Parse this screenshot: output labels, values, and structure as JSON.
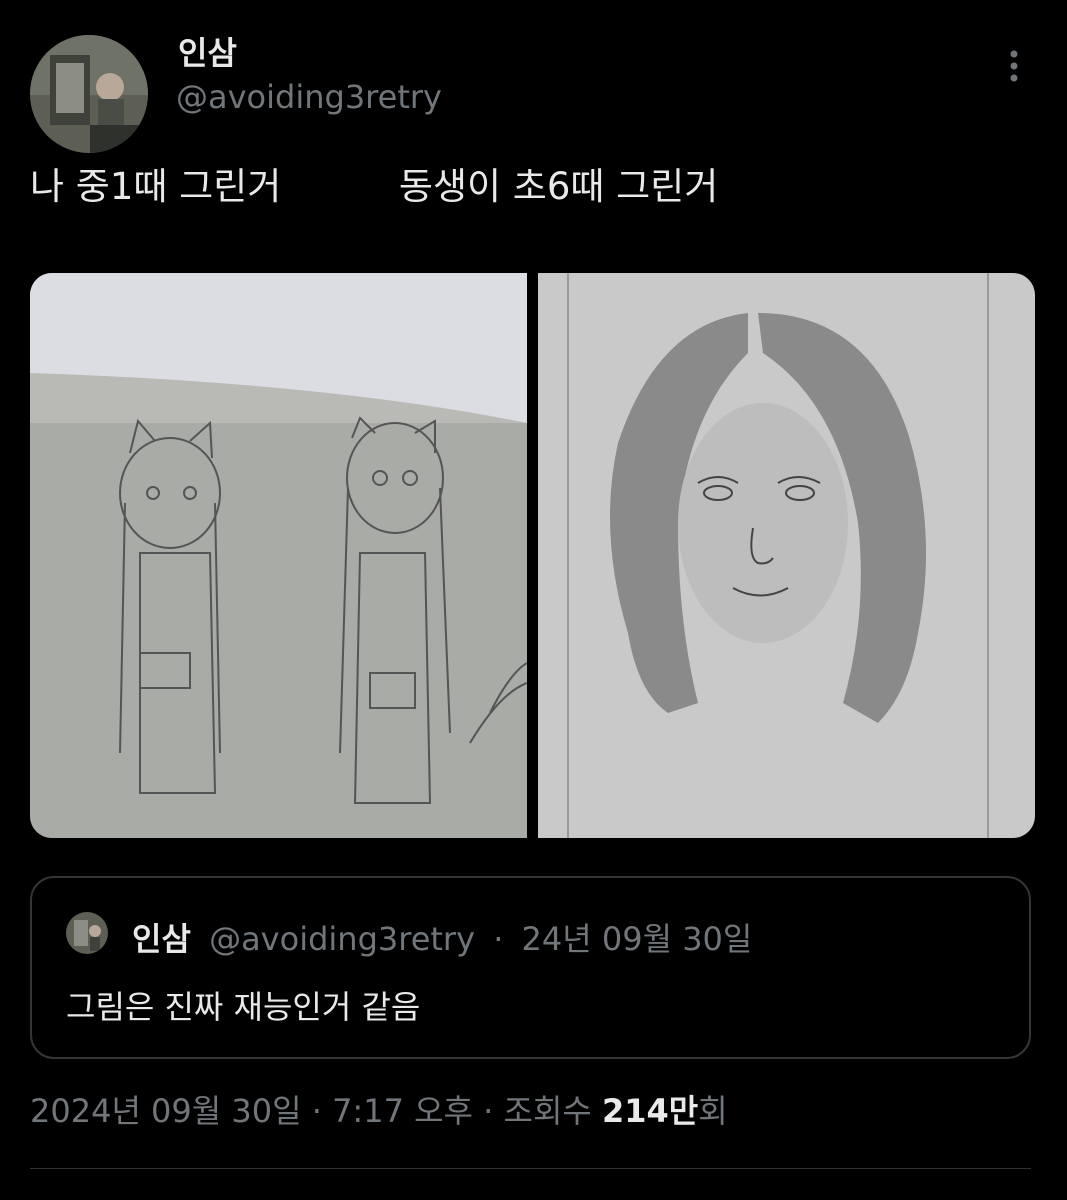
{
  "author": {
    "display_name": "인삼",
    "handle": "@avoiding3retry"
  },
  "tweet": {
    "text": "나 중1때 그린거          동생이 초6때 그린거"
  },
  "quoted_tweet": {
    "display_name": "인삼",
    "handle": "@avoiding3retry",
    "separator": "·",
    "date": "24년 09월 30일",
    "text": "그림은 진짜 재능인거 같음"
  },
  "footer": {
    "date": "2024년 09월 30일",
    "separator1": "·",
    "time": "7:17 오후",
    "separator2": "·",
    "views_label": "조회수",
    "views_count": "214만",
    "views_suffix": "회"
  },
  "icons": {
    "more": "more-vertical-icon"
  },
  "colors": {
    "background": "#000000",
    "primary_text": "#e7e9ea",
    "secondary_text": "#71767b",
    "border": "#333639"
  }
}
